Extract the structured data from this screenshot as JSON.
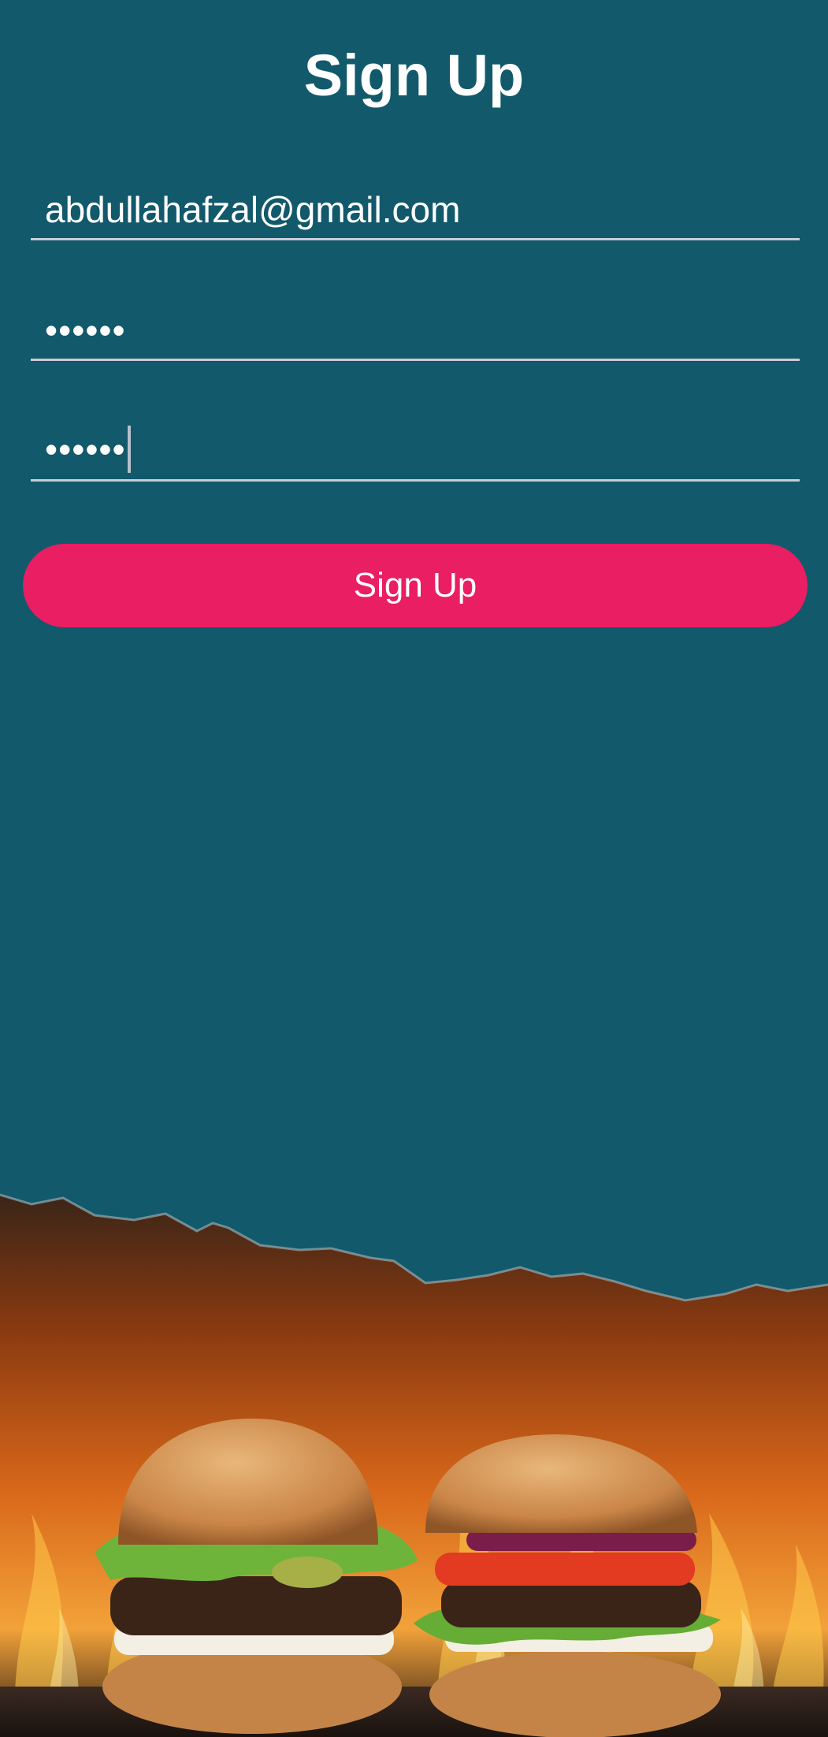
{
  "title": "Sign Up",
  "form": {
    "email_value": "abdullahafzal@gmail.com",
    "password_value": "••••••",
    "confirm_password_value": "••••••"
  },
  "button": {
    "label": "Sign Up"
  },
  "colors": {
    "background": "#11596b",
    "accent": "#e91e63",
    "underline": "#c9ccd6"
  },
  "image": {
    "semantic": "burgers-with-flames-image"
  }
}
